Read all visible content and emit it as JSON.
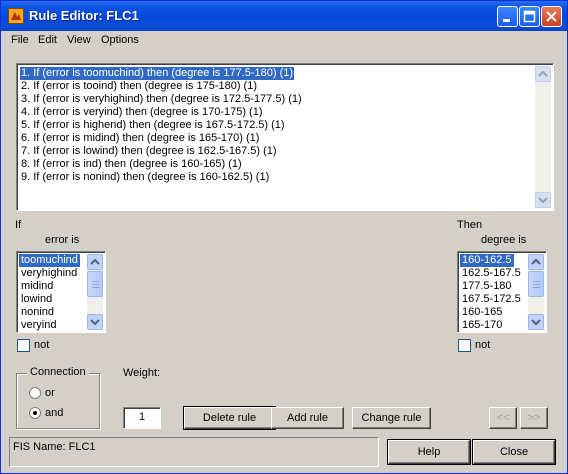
{
  "window": {
    "title": "Rule Editor: FLC1"
  },
  "menu": [
    "File",
    "Edit",
    "View",
    "Options"
  ],
  "rules": [
    "1. If (error is toomuchind) then (degree is 177.5-180) (1)",
    "2. If (error is tooind) then (degree is 175-180) (1)",
    "3. If (error is veryhighind) then (degree is 172.5-177.5) (1)",
    "4. If (error is veryind) then (degree is 170-175) (1)",
    "5. If (error is highend) then (degree is 167.5-172.5) (1)",
    "6. If (error is midind) then (degree is 165-170) (1)",
    "7. If (error is lowind) then (degree is 162.5-167.5) (1)",
    "8. If (error is ind) then (degree is 160-165) (1)",
    "9. If (error is nonind) then (degree is 160-162.5) (1)"
  ],
  "selected_rule": 1,
  "if_section": {
    "label": "If",
    "variable_label": "error is",
    "options": [
      "toomuchind",
      "veryhighind",
      "midind",
      "lowind",
      "nonind",
      "veryind"
    ],
    "selected": "toomuchind",
    "not_label": "not",
    "not_checked": false
  },
  "then_section": {
    "label": "Then",
    "variable_label": "degree is",
    "options": [
      "160-162.5",
      "162.5-167.5",
      "177.5-180",
      "167.5-172.5",
      "160-165",
      "165-170"
    ],
    "selected": "160-162.5",
    "not_label": "not",
    "not_checked": false
  },
  "connection": {
    "title": "Connection",
    "options": [
      "or",
      "and"
    ],
    "selected": "and"
  },
  "weight": {
    "label": "Weight:",
    "value": "1"
  },
  "buttons": {
    "delete": "Delete rule",
    "add": "Add rule",
    "change": "Change rule",
    "prev": "<<",
    "next": ">>",
    "help": "Help",
    "close": "Close"
  },
  "status": "FIS Name: FLC1",
  "colors": {
    "selection": "#316ac5",
    "titlebar": "#0a54e4",
    "face": "#d4d0c8"
  }
}
